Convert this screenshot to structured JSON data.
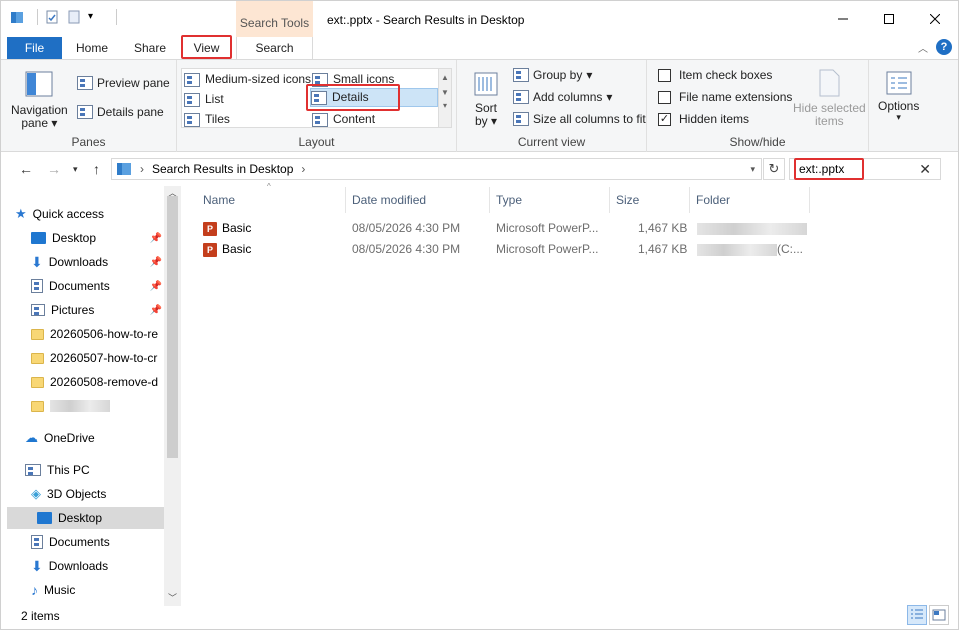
{
  "title": "ext:.pptx - Search Results in Desktop",
  "context_tab": "Search Tools",
  "tabs": {
    "file": "File",
    "home": "Home",
    "share": "Share",
    "view": "View",
    "search": "Search"
  },
  "ribbon": {
    "panes": {
      "label": "Panes",
      "navigation": "Navigation",
      "navigation2": "pane",
      "preview": "Preview pane",
      "details": "Details pane"
    },
    "layout": {
      "label": "Layout",
      "medium_icons": "Medium-sized icons",
      "small_icons": "Small icons",
      "list": "List",
      "details": "Details",
      "tiles": "Tiles",
      "content": "Content"
    },
    "current_view": {
      "label": "Current view",
      "sort": "Sort",
      "sort2": "by",
      "group_by": "Group by",
      "add_columns": "Add columns",
      "size_all": "Size all columns to fit"
    },
    "show_hide": {
      "label": "Show/hide",
      "item_check": "Item check boxes",
      "file_ext": "File name extensions",
      "hidden": "Hidden items",
      "hide_selected": "Hide selected",
      "hide_selected2": "items",
      "hidden_checked": "✓"
    },
    "options": "Options"
  },
  "address": {
    "path": "Search Results in Desktop",
    "search_value": "ext:.pptx"
  },
  "nav": {
    "quick_access": "Quick access",
    "items": [
      "Desktop",
      "Downloads",
      "Documents",
      "Pictures",
      "20260506-how-to-re",
      "20260507-how-to-cr",
      "20260508-remove-d"
    ],
    "onedrive": "OneDrive",
    "this_pc": "This PC",
    "pc_items": [
      "3D Objects",
      "Desktop",
      "Documents",
      "Downloads",
      "Music"
    ]
  },
  "columns": {
    "name": "Name",
    "date": "Date modified",
    "type": "Type",
    "size": "Size",
    "folder": "Folder"
  },
  "files": [
    {
      "name": "Basic",
      "date": "08/05/2026 4:30 PM",
      "type": "Microsoft PowerP...",
      "size": "1,467 KB",
      "folder": ""
    },
    {
      "name": "Basic",
      "date": "08/05/2026 4:30 PM",
      "type": "Microsoft PowerP...",
      "size": "1,467 KB",
      "folder": "(C:..."
    }
  ],
  "status": "2 items",
  "colors": {
    "accent": "#1f6fc4",
    "highlight": "#e03030",
    "context": "#fde6d3"
  }
}
